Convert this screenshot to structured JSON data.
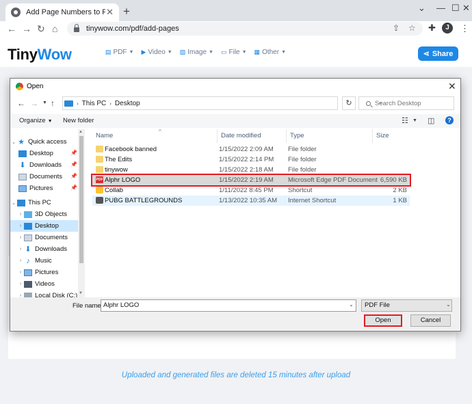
{
  "browser": {
    "tab_title": "Add Page Numbers to PDF Free",
    "url": "tinywow.com/pdf/add-pages",
    "profile_initial": "J"
  },
  "site": {
    "logo_tiny": "Tiny",
    "logo_wow": "Wow",
    "nav": [
      {
        "label": "PDF",
        "icon": "pdf-icon"
      },
      {
        "label": "Video",
        "icon": "video-icon"
      },
      {
        "label": "Image",
        "icon": "image-icon"
      },
      {
        "label": "File",
        "icon": "file-icon"
      },
      {
        "label": "Other",
        "icon": "other-icon"
      }
    ],
    "share_label": "Share",
    "notice": "Uploaded and generated files are deleted 15 minutes after upload",
    "accent_color": "#1e88e5"
  },
  "dialog": {
    "title": "Open",
    "breadcrumb": [
      "This PC",
      "Desktop"
    ],
    "search_placeholder": "Search Desktop",
    "organize_label": "Organize",
    "new_folder_label": "New folder",
    "tree": [
      {
        "label": "Quick access",
        "expanded": true
      },
      {
        "label": "Desktop",
        "pinned": true
      },
      {
        "label": "Downloads",
        "pinned": true
      },
      {
        "label": "Documents",
        "pinned": true
      },
      {
        "label": "Pictures",
        "pinned": true
      },
      {
        "label": "This PC",
        "expanded": true
      },
      {
        "label": "3D Objects"
      },
      {
        "label": "Desktop",
        "selected": true
      },
      {
        "label": "Documents"
      },
      {
        "label": "Downloads"
      },
      {
        "label": "Music"
      },
      {
        "label": "Pictures"
      },
      {
        "label": "Videos"
      },
      {
        "label": "Local Disk (C:)"
      }
    ],
    "columns": {
      "name": "Name",
      "date": "Date modified",
      "type": "Type",
      "size": "Size"
    },
    "files": [
      {
        "name": "Facebook banned",
        "date": "1/15/2022 2:09 AM",
        "type": "File folder",
        "size": "",
        "icon": "folder-icon"
      },
      {
        "name": "The Edits",
        "date": "1/15/2022 2:14 PM",
        "type": "File folder",
        "size": "",
        "icon": "folder-icon"
      },
      {
        "name": "tinywow",
        "date": "1/15/2022 2:18 AM",
        "type": "File folder",
        "size": "",
        "icon": "folder-icon"
      },
      {
        "name": "Alphr LOGO",
        "date": "1/15/2022 2:19 AM",
        "type": "Microsoft Edge PDF Document",
        "size": "6,590 KB",
        "icon": "pdf-file-icon",
        "selected": true
      },
      {
        "name": "Collab",
        "date": "1/11/2022 8:45 PM",
        "type": "Shortcut",
        "size": "2 KB",
        "icon": "shortcut-icon"
      },
      {
        "name": "PUBG BATTLEGROUNDS",
        "date": "1/13/2022 10:35 AM",
        "type": "Internet Shortcut",
        "size": "1 KB",
        "icon": "internet-shortcut-icon"
      }
    ],
    "file_name_label": "File name:",
    "file_name_value": "Alphr LOGO",
    "file_type_value": "PDF File",
    "open_label": "Open",
    "cancel_label": "Cancel",
    "highlight_color": "#e21b23"
  }
}
